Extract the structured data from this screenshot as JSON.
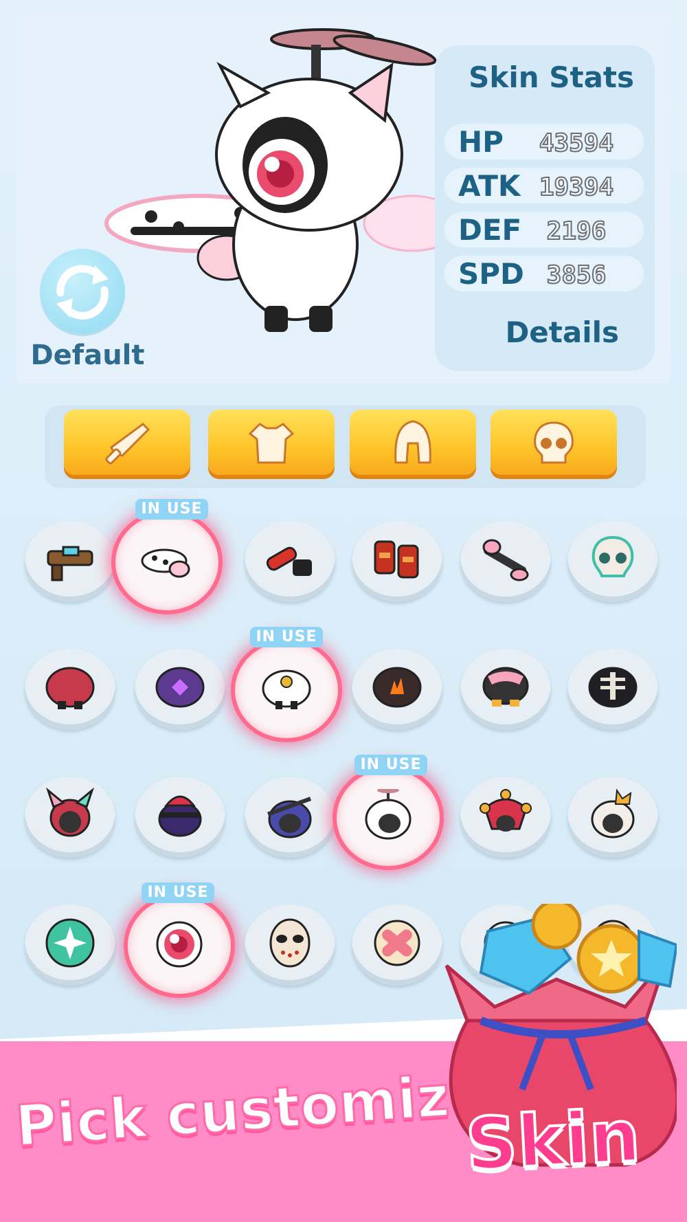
{
  "stats_panel": {
    "title": "Skin Stats",
    "rows": [
      {
        "name": "HP",
        "value": "43594"
      },
      {
        "name": "ATK",
        "value": "19394"
      },
      {
        "name": "DEF",
        "value": "2196"
      },
      {
        "name": "SPD",
        "value": "3856"
      }
    ],
    "details_label": "Details"
  },
  "reset": {
    "label": "Default",
    "icon": "refresh-icon"
  },
  "category_tabs": [
    {
      "icon": "sword-icon"
    },
    {
      "icon": "shirt-icon"
    },
    {
      "icon": "helmet-icon"
    },
    {
      "icon": "skull-icon"
    }
  ],
  "in_use_label": "IN USE",
  "banner": {
    "tagline_1": "Pick customized",
    "tagline_2": "Skin"
  },
  "colors": {
    "accent_yellow": "#ffc42a",
    "title_blue": "#1d6184",
    "banner_pink": "#ff8cc6",
    "selected_glow": "#ff6a8f"
  }
}
